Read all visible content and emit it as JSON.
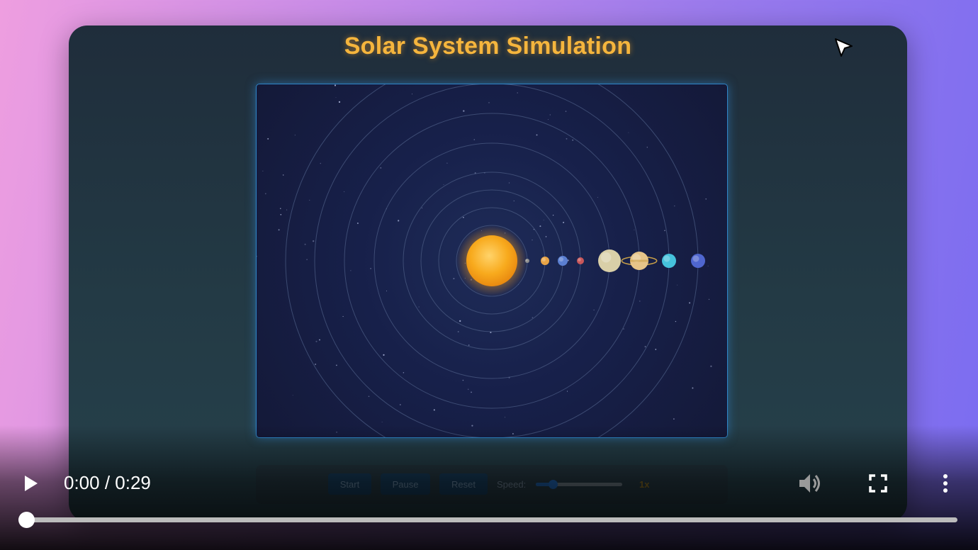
{
  "app": {
    "title": "Solar System Simulation"
  },
  "simulation": {
    "sun": {
      "name": "sun",
      "color": "#f5a51c"
    },
    "planets": [
      {
        "name": "mercury",
        "color": "#8f8f8f"
      },
      {
        "name": "venus",
        "color": "#e8a447"
      },
      {
        "name": "earth",
        "color": "#5b7fd1"
      },
      {
        "name": "mars",
        "color": "#c9575a"
      },
      {
        "name": "jupiter",
        "color": "#d9cfa8"
      },
      {
        "name": "saturn",
        "color": "#e6c489",
        "ring_color": "#c9a048"
      },
      {
        "name": "uranus",
        "color": "#45c2dc"
      },
      {
        "name": "neptune",
        "color": "#4f66cf"
      }
    ],
    "orbit_color": "#4a5a82"
  },
  "controls": {
    "start_label": "Start",
    "pause_label": "Pause",
    "reset_label": "Reset",
    "speed_label": "Speed:",
    "speed_value": "1x",
    "speed_fraction": 0.2
  },
  "player": {
    "time": "0:00 / 0:29",
    "progress_fraction": 0,
    "icons": [
      "play-icon",
      "volume-icon",
      "fullscreen-icon",
      "more-options-icon",
      "mouse-cursor-icon"
    ]
  },
  "colors": {
    "title": "#f5b53d",
    "canvas_border": "#2f86c9",
    "button_bg": "#173e5e"
  }
}
